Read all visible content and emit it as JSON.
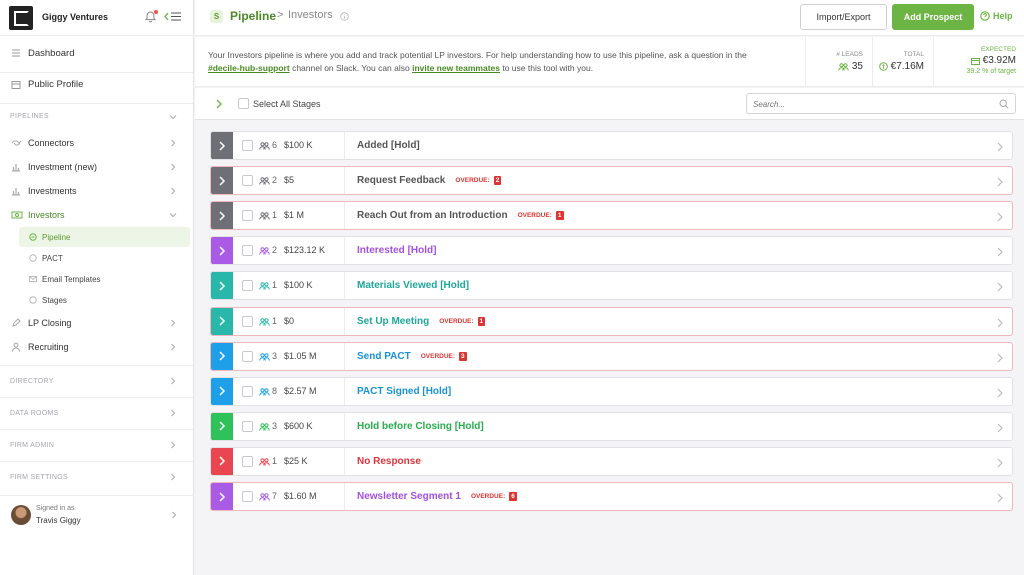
{
  "sidebar": {
    "firm_name": "Giggy Ventures",
    "nav_top": [
      {
        "label": "Dashboard",
        "icon": "dashboard-icon"
      },
      {
        "label": "Public Profile",
        "icon": "profile-icon"
      }
    ],
    "sections": {
      "pipelines": "PIPELINES",
      "directory": "DIRECTORY",
      "data_rooms": "DATA ROOMS",
      "firm_admin": "FIRM ADMIN",
      "firm_settings": "FIRM SETTINGS"
    },
    "pipelines": [
      {
        "label": "Connectors",
        "icon": "handshake-icon"
      },
      {
        "label": "Investment (new)",
        "icon": "bar-chart-icon"
      },
      {
        "label": "Investments",
        "icon": "bar-chart-icon"
      },
      {
        "label": "Investors",
        "icon": "money-icon"
      }
    ],
    "investors_sub": [
      {
        "label": "Pipeline",
        "icon": "pipeline-icon",
        "active": true
      },
      {
        "label": "PACT",
        "icon": "pact-icon"
      },
      {
        "label": "Email Templates",
        "icon": "email-icon"
      },
      {
        "label": "Stages",
        "icon": "stages-icon"
      }
    ],
    "more": [
      {
        "label": "LP Closing",
        "icon": "pen-icon"
      },
      {
        "label": "Recruiting",
        "icon": "person-icon"
      }
    ],
    "user": {
      "signed_in_as": "Signed in as",
      "name": "Travis Giggy"
    }
  },
  "header": {
    "badge": "S",
    "breadcrumb_root": "Pipeline",
    "breadcrumb_sep": ">",
    "breadcrumb_current": "Investors",
    "import_export": "Import/Export",
    "add_prospect": "Add Prospect",
    "help": "Help"
  },
  "banner": {
    "text1": "Your Investors pipeline is where you add and track potential LP investors. For help understanding how to use this pipeline, ask a question in the ",
    "link1": "#decile-hub-support",
    "text2": " channel on Slack. You can also ",
    "link2": "invite new teammates",
    "text3": " to use this tool with you.",
    "stats": {
      "leads_label": "# LEADS",
      "leads_value": "35",
      "total_label": "TOTAL",
      "total_value": "€7.16M",
      "expected_label": "EXPECTED",
      "expected_value": "€3.92M",
      "expected_sub": "39.2 % of target"
    }
  },
  "filter": {
    "select_all": "Select All Stages",
    "search_placeholder": "Search..."
  },
  "overdue_label": "OVERDUE:",
  "stages": [
    {
      "name": "Added [Hold]",
      "count": "6",
      "amount": "$100 K",
      "color": "#6f6f76",
      "text_color": "#555555",
      "overdue": null
    },
    {
      "name": "Request Feedback",
      "count": "2",
      "amount": "$5",
      "color": "#6f6f76",
      "text_color": "#555555",
      "overdue": "2"
    },
    {
      "name": "Reach Out from an Introduction",
      "count": "1",
      "amount": "$1 M",
      "color": "#6f6f76",
      "text_color": "#555555",
      "overdue": "1"
    },
    {
      "name": "Interested [Hold]",
      "count": "2",
      "amount": "$123.12 K",
      "color": "#a95be6",
      "text_color": "#a351e0",
      "overdue": null
    },
    {
      "name": "Materials Viewed [Hold]",
      "count": "1",
      "amount": "$100 K",
      "color": "#29b7a9",
      "text_color": "#1fa799",
      "overdue": null
    },
    {
      "name": "Set Up Meeting",
      "count": "1",
      "amount": "$0",
      "color": "#29b7a9",
      "text_color": "#1fa799",
      "overdue": "1"
    },
    {
      "name": "Send PACT",
      "count": "3",
      "amount": "$1.05 M",
      "color": "#1ea0e8",
      "text_color": "#1a93d6",
      "overdue": "3"
    },
    {
      "name": "PACT Signed [Hold]",
      "count": "8",
      "amount": "$2.57 M",
      "color": "#1ea0e8",
      "text_color": "#1a93d6",
      "overdue": null
    },
    {
      "name": "Hold before Closing [Hold]",
      "count": "3",
      "amount": "$600 K",
      "color": "#2fc15a",
      "text_color": "#27ad4d",
      "overdue": null
    },
    {
      "name": "No Response",
      "count": "1",
      "amount": "$25 K",
      "color": "#ea4650",
      "text_color": "#d9343e",
      "overdue": null
    },
    {
      "name": "Newsletter Segment 1",
      "count": "7",
      "amount": "$1.60 M",
      "color": "#a95be6",
      "text_color": "#a351e0",
      "overdue": "6"
    }
  ]
}
